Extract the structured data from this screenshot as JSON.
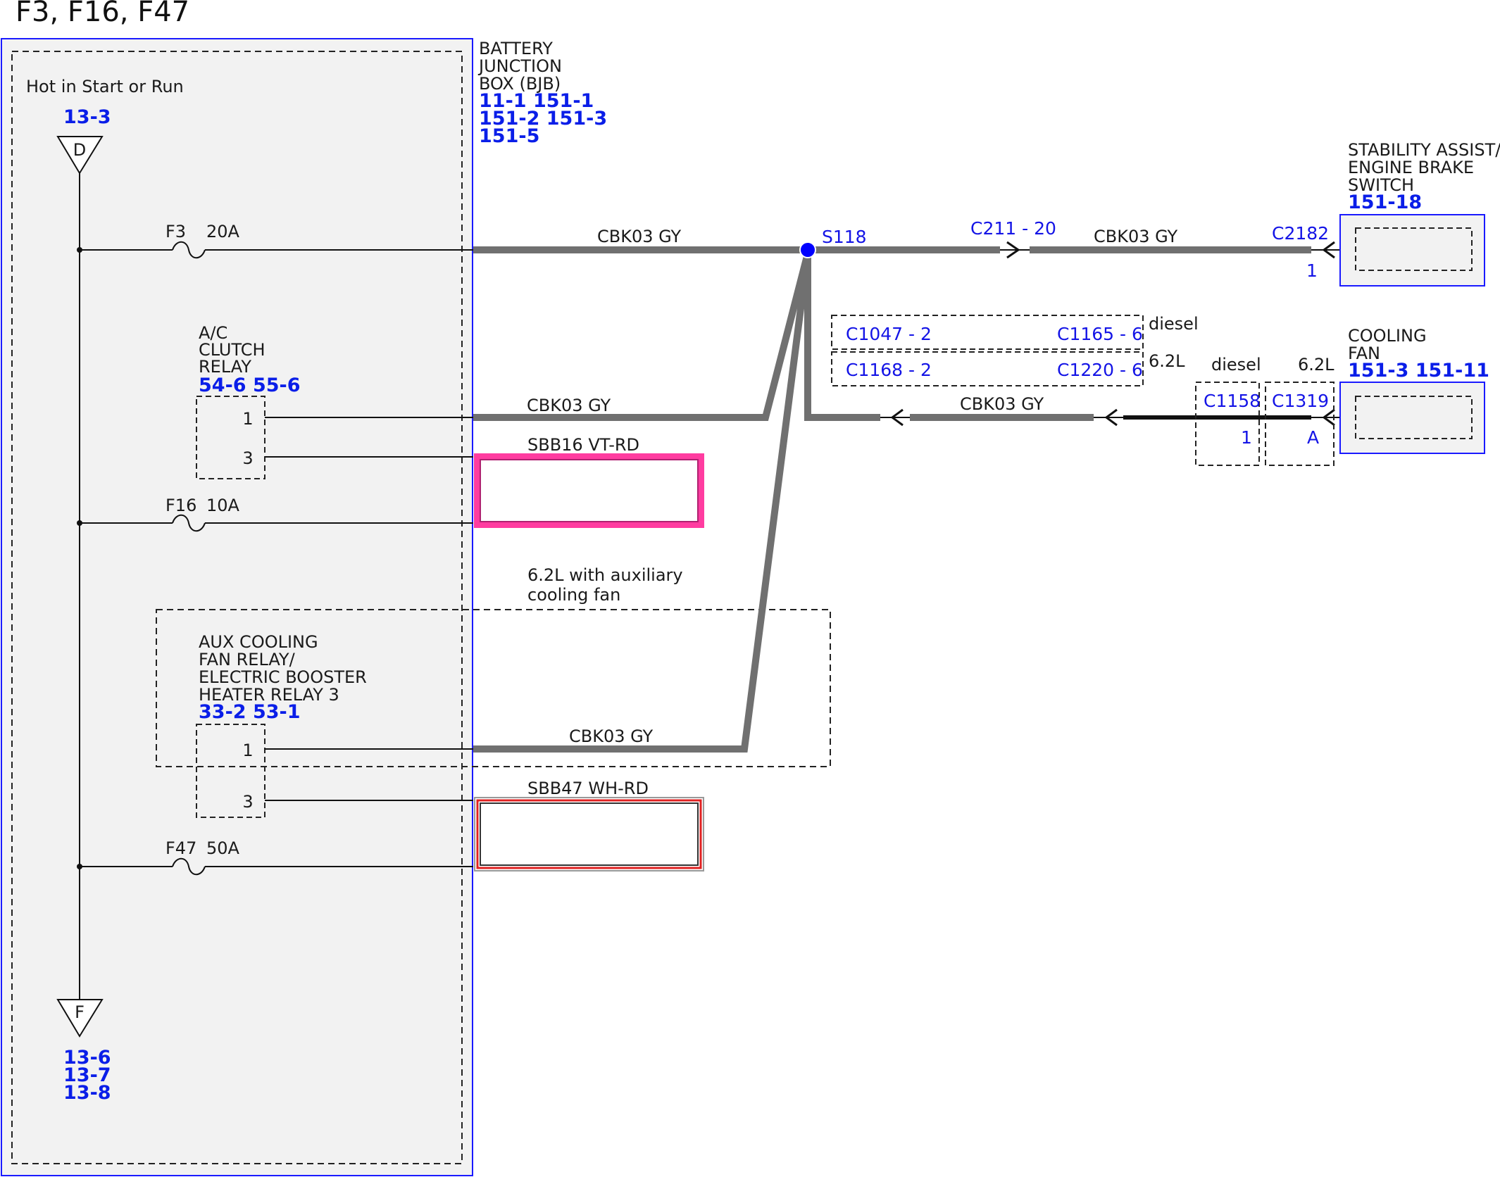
{
  "title": "F3, F16, F47",
  "colors": {
    "panel_border": "#1a1aff",
    "panel_fill": "#f2f2f2",
    "wire_gray": "#7a7a7a",
    "splice_dot": "#0000ff",
    "ref_blue": "#0a1ee8",
    "violet_red": "#ff3ca0",
    "white_red": "#e02020"
  },
  "bjb": {
    "label_lines": [
      "BATTERY",
      "JUNCTION",
      "BOX (BJB)"
    ],
    "refs": [
      "11-1  151-1",
      "151-2 151-3",
      "151-5"
    ],
    "hot_label": "Hot in Start or Run",
    "top_ref": "13-3",
    "top_symbol": "D",
    "bottom_symbol": "F",
    "bottom_refs": [
      "13-6",
      "13-7",
      "13-8"
    ]
  },
  "fuses": [
    {
      "name": "F3",
      "rating": "20A"
    },
    {
      "name": "F16",
      "rating": "10A"
    },
    {
      "name": "F47",
      "rating": "50A"
    }
  ],
  "ac_relay": {
    "label_lines": [
      "A/C",
      "CLUTCH",
      "RELAY"
    ],
    "refs": "54-6   55-6",
    "pins": [
      "1",
      "3"
    ]
  },
  "aux_relay": {
    "label_lines": [
      "AUX COOLING",
      "FAN RELAY/",
      "ELECTRIC BOOSTER",
      "HEATER RELAY 3"
    ],
    "refs": "33-2   53-1",
    "pins": [
      "1",
      "3"
    ],
    "option_lines": [
      "6.2L with auxiliary",
      "cooling fan"
    ]
  },
  "wires": {
    "cbk03_gy": "CBK03   GY",
    "sbb16": "SBB16   VT-RD",
    "sbb47": "SBB47   WH-RD"
  },
  "splice": "S118",
  "connectors": {
    "c211": "C211 - 20",
    "c2182": "C2182",
    "c2182_pin": "1",
    "c1047": "C1047 - 2",
    "c1165": "C1165 - 6",
    "c1168": "C1168 - 2",
    "c1220": "C1220 - 6",
    "c1158": "C1158",
    "c1158_pin": "1",
    "c1319": "C1319",
    "c1319_pin": "A",
    "diesel": "diesel",
    "v62": "6.2L"
  },
  "stability_switch": {
    "label_lines": [
      "STABILITY ASSIST/",
      "ENGINE BRAKE",
      "SWITCH"
    ],
    "ref": "151-18"
  },
  "cooling_fan": {
    "label_lines": [
      "COOLING",
      "FAN"
    ],
    "refs": "151-3   151-11"
  }
}
